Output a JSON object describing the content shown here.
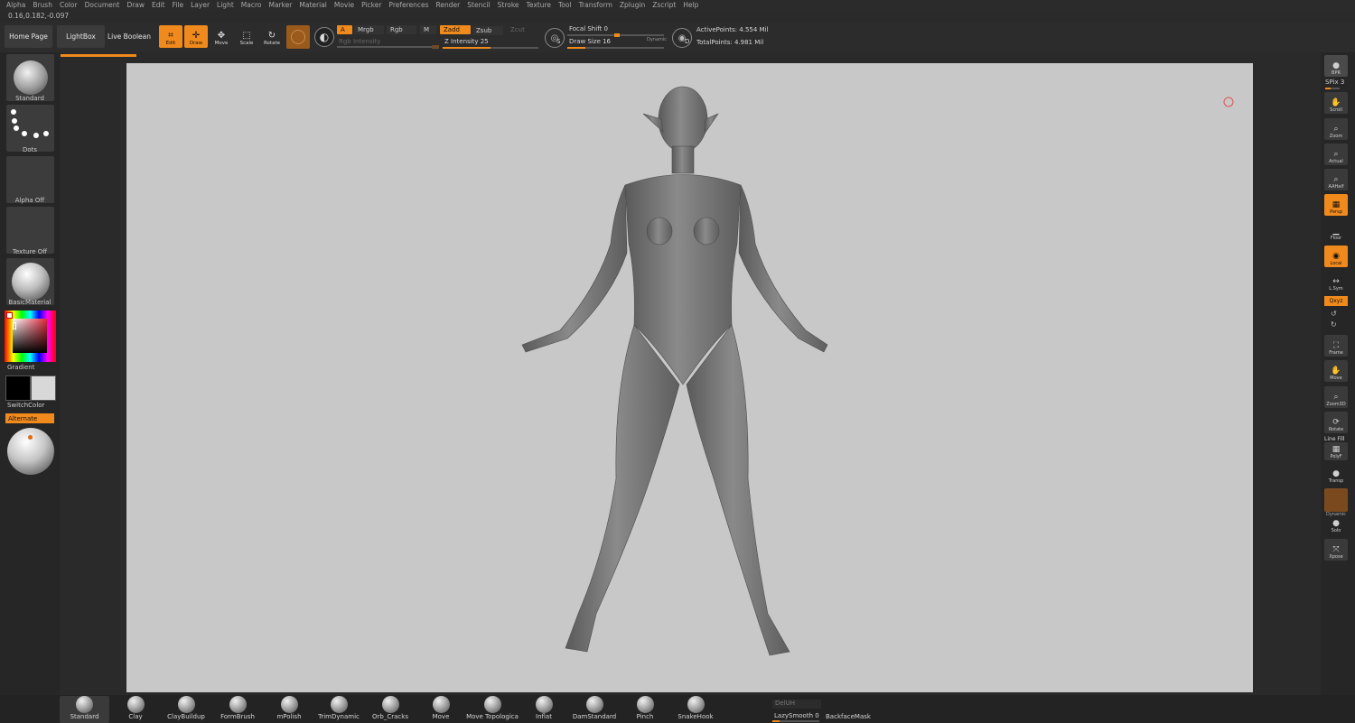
{
  "menu": [
    "Alpha",
    "Brush",
    "Color",
    "Document",
    "Draw",
    "Edit",
    "File",
    "Layer",
    "Light",
    "Macro",
    "Marker",
    "Material",
    "Movie",
    "Picker",
    "Preferences",
    "Render",
    "Stencil",
    "Stroke",
    "Texture",
    "Tool",
    "Transform",
    "Zplugin",
    "Zscript",
    "Help"
  ],
  "coords": "0.16,0.182,-0.097",
  "top": {
    "home": "Home Page",
    "lightbox": "LightBox",
    "liveboolean": "Live Boolean",
    "tools": {
      "edit": "Edit",
      "draw": "Draw",
      "move": "Move",
      "scale": "Scale",
      "rotate": "Rotate"
    },
    "a_label": "A",
    "mrgb": "Mrgb",
    "rgb": "Rgb",
    "m": "M",
    "zadd": "Zadd",
    "zsub": "Zsub",
    "zcut": "Zcut",
    "rgb_intensity": "Rgb Intensity",
    "z_intensity": "Z Intensity 25",
    "focal_shift": "Focal Shift 0",
    "draw_size": "Draw Size 16",
    "dynamic": "Dynamic",
    "s_label": "S",
    "d_label": "D",
    "active_points": "ActivePoints: 4.554 Mil",
    "total_points": "TotalPoints: 4.981 Mil",
    "z_intensity_value": 25,
    "draw_size_value": 16,
    "focal_shift_value": 0
  },
  "left": {
    "brush": "Standard",
    "stroke": "Dots",
    "alpha": "Alpha Off",
    "texture": "Texture Off",
    "material": "BasicMaterial",
    "gradient": "Gradient",
    "switchcolor": "SwitchColor",
    "alternate": "Alternate"
  },
  "right": {
    "bpr": "BPR",
    "spix": "SPix 3",
    "scroll": "Scroll",
    "zoom": "Zoom",
    "actual": "Actual",
    "aahalf": "AAHalf",
    "persp": "Persp",
    "floor": "Floor",
    "local": "Local",
    "lsym": "L.Sym",
    "xyz": "Qxyz",
    "frame": "Frame",
    "move": "Move",
    "zoom3d": "Zoom3D",
    "rotate": "Rotate",
    "linefill": "Line Fill",
    "polyf": "PolyF",
    "transp": "Transp",
    "dynamic": "Dynamic",
    "solo": "Solo",
    "xpose": "Xpose"
  },
  "bottom": {
    "brushes": [
      "Standard",
      "Clay",
      "ClayBuildup",
      "FormBrush",
      "mPolish",
      "TrimDynamic",
      "Orb_Cracks",
      "Move",
      "Move Topologica",
      "Inflat",
      "DamStandard",
      "Pinch",
      "SnakeHook"
    ],
    "delhidden": "DelUH",
    "lazysmooth": "LazySmooth 0",
    "backfacemask": "BackfaceMask"
  },
  "colors": {
    "accent": "#f18a1c",
    "panel": "#2a2a2a",
    "canvas": "#c8c8c8"
  }
}
